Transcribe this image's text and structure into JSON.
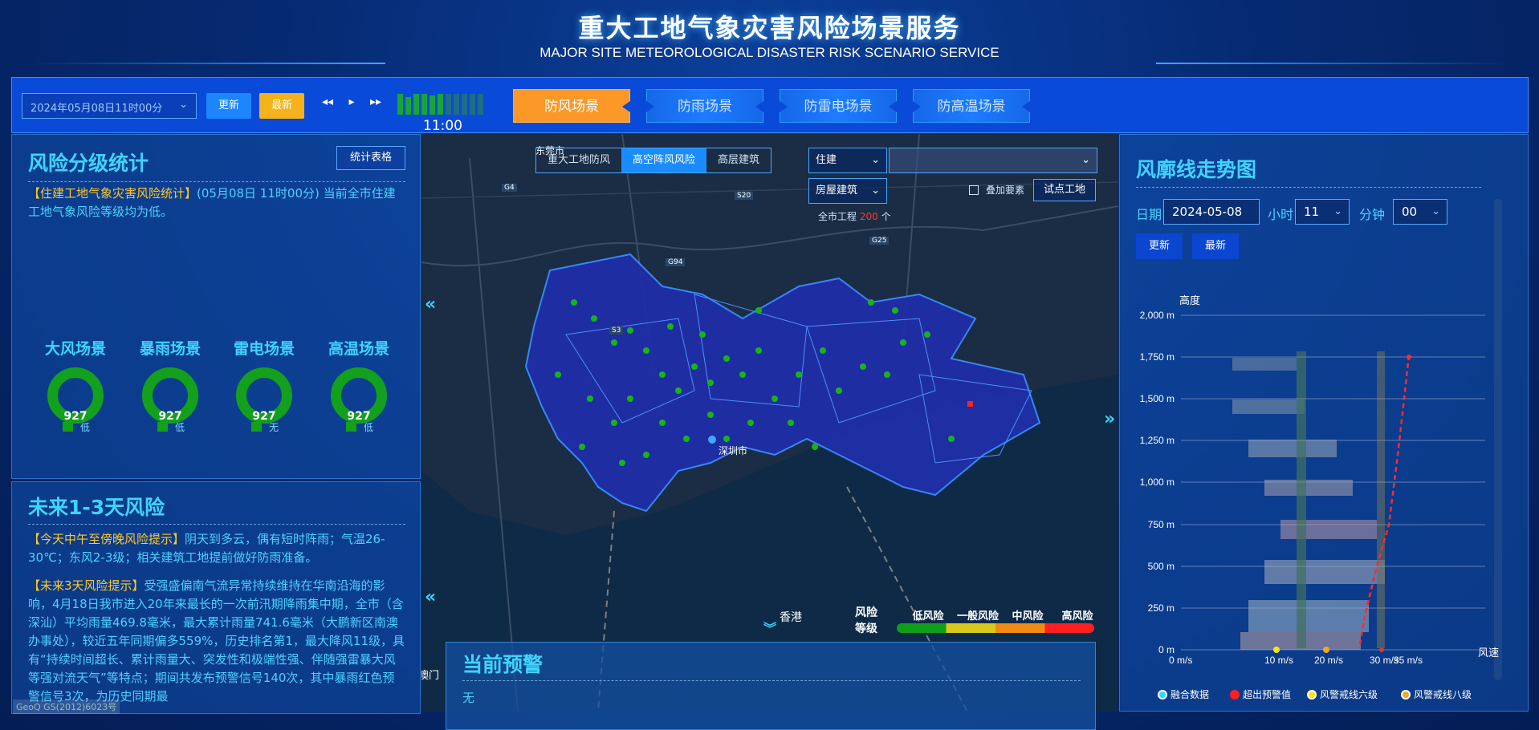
{
  "header": {
    "title": "重大工地气象灾害风险场景服务",
    "subtitle": "MAJOR SITE METEOROLOGICAL DISASTER RISK SCENARIO SERVICE"
  },
  "toolbar": {
    "datetime_value": "2024年05月08日11时00分",
    "update_label": "更新",
    "latest_label": "最新",
    "prev_icon": "rewind-icon",
    "play_icon": "play-icon",
    "next_icon": "fast-forward-icon",
    "time_label": "11:00",
    "scene_tabs": [
      {
        "label": "防风场景",
        "active": true
      },
      {
        "label": "防雨场景",
        "active": false
      },
      {
        "label": "防雷电场景",
        "active": false
      },
      {
        "label": "防高温场景",
        "active": false
      }
    ]
  },
  "risk_stats": {
    "title": "风险分级统计",
    "table_button": "统计表格",
    "notice_tag": "【住建工地气象灾害风险统计】",
    "notice_text": "(05月08日 11时00分) 当前全市住建工地气象风险等级均为低。",
    "gauges": [
      {
        "label": "大风场景",
        "value": "927",
        "level": "低"
      },
      {
        "label": "暴雨场景",
        "value": "927",
        "level": "低"
      },
      {
        "label": "雷电场景",
        "value": "927",
        "level": "无"
      },
      {
        "label": "高温场景",
        "value": "927",
        "level": "低"
      }
    ]
  },
  "future_risk": {
    "title": "未来1-3天风险",
    "p1_tag": "【今天中午至傍晚风险提示】",
    "p1_text": "阴天到多云，偶有短时阵雨；气温26-30℃；东风2-3级；相关建筑工地提前做好防雨准备。",
    "p2_tag": "【未来3天风险提示】",
    "p2_text": "受强盛偏南气流异常持续维持在华南沿海的影响，4月18日我市进入20年来最长的一次前汛期降雨集中期，全市（含深汕）平均雨量469.8毫米，最大累计雨量741.6毫米（大鹏新区南澳办事处），较近五年同期偏多559%，历史排名第1，最大降风11级，具有“持续时间超长、累计雨量大、突发性和极端性强、伴随强雷暴大风等强对流天气”等特点；期间共发布预警信号140次，其中暴雨红色预警信号3次，为历史同期最"
  },
  "map": {
    "mode_tabs": [
      {
        "label": "重大工地防风",
        "active": false
      },
      {
        "label": "高空阵风风险",
        "active": true
      },
      {
        "label": "高层建筑",
        "active": false
      }
    ],
    "dept_select": "住建",
    "type_select": "房屋建筑",
    "overlay_label": "叠加要素",
    "pilot_button": "试点工地",
    "count_prefix": "全市工程",
    "count_value": "200",
    "count_unit": "个",
    "place_labels": [
      "东莞市",
      "深圳市",
      "香港",
      "澳门"
    ],
    "road_badges": [
      "G4",
      "S20",
      "G25",
      "G94",
      "S3"
    ],
    "legend_title_1": "风险",
    "legend_title_2": "等级",
    "legend_levels": [
      {
        "label": "低风险",
        "color": "#0f9f1c"
      },
      {
        "label": "一般风险",
        "color": "#d8c91a"
      },
      {
        "label": "中风险",
        "color": "#f08a12"
      },
      {
        "label": "高风险",
        "color": "#ff1f1f"
      }
    ],
    "collapse_left_icon": "double-chevron-left-icon",
    "collapse_right_icon": "double-chevron-right-icon",
    "expand_down_icon": "double-chevron-down-icon"
  },
  "warning": {
    "title": "当前预警",
    "content": "无"
  },
  "profile": {
    "title": "风廓线走势图",
    "date_label": "日期",
    "date_value": "2024-05-08",
    "hour_label": "小时",
    "hour_value": "11",
    "minute_label": "分钟",
    "minute_value": "00",
    "update_label": "更新",
    "latest_label": "最新",
    "y_title": "高度",
    "x_title": "风速",
    "y_ticks": [
      "2,000 m",
      "1,750 m",
      "1,500 m",
      "1,250 m",
      "1,000 m",
      "750 m",
      "500 m",
      "250 m",
      "0 m"
    ],
    "x_ticks": [
      "0 m/s",
      "10 m/s",
      "20 m/s",
      "30 m/s",
      "35 m/s"
    ],
    "legend": [
      {
        "label": "融合数据",
        "color": "#2fd9ff"
      },
      {
        "label": "超出预警值",
        "color": "#ff1f1f"
      },
      {
        "label": "风警戒线六级",
        "color": "#ffe600"
      },
      {
        "label": "风警戒线八级",
        "color": "#f5a623"
      }
    ]
  },
  "watermark": "GeoQ GS(2012)6023号"
}
